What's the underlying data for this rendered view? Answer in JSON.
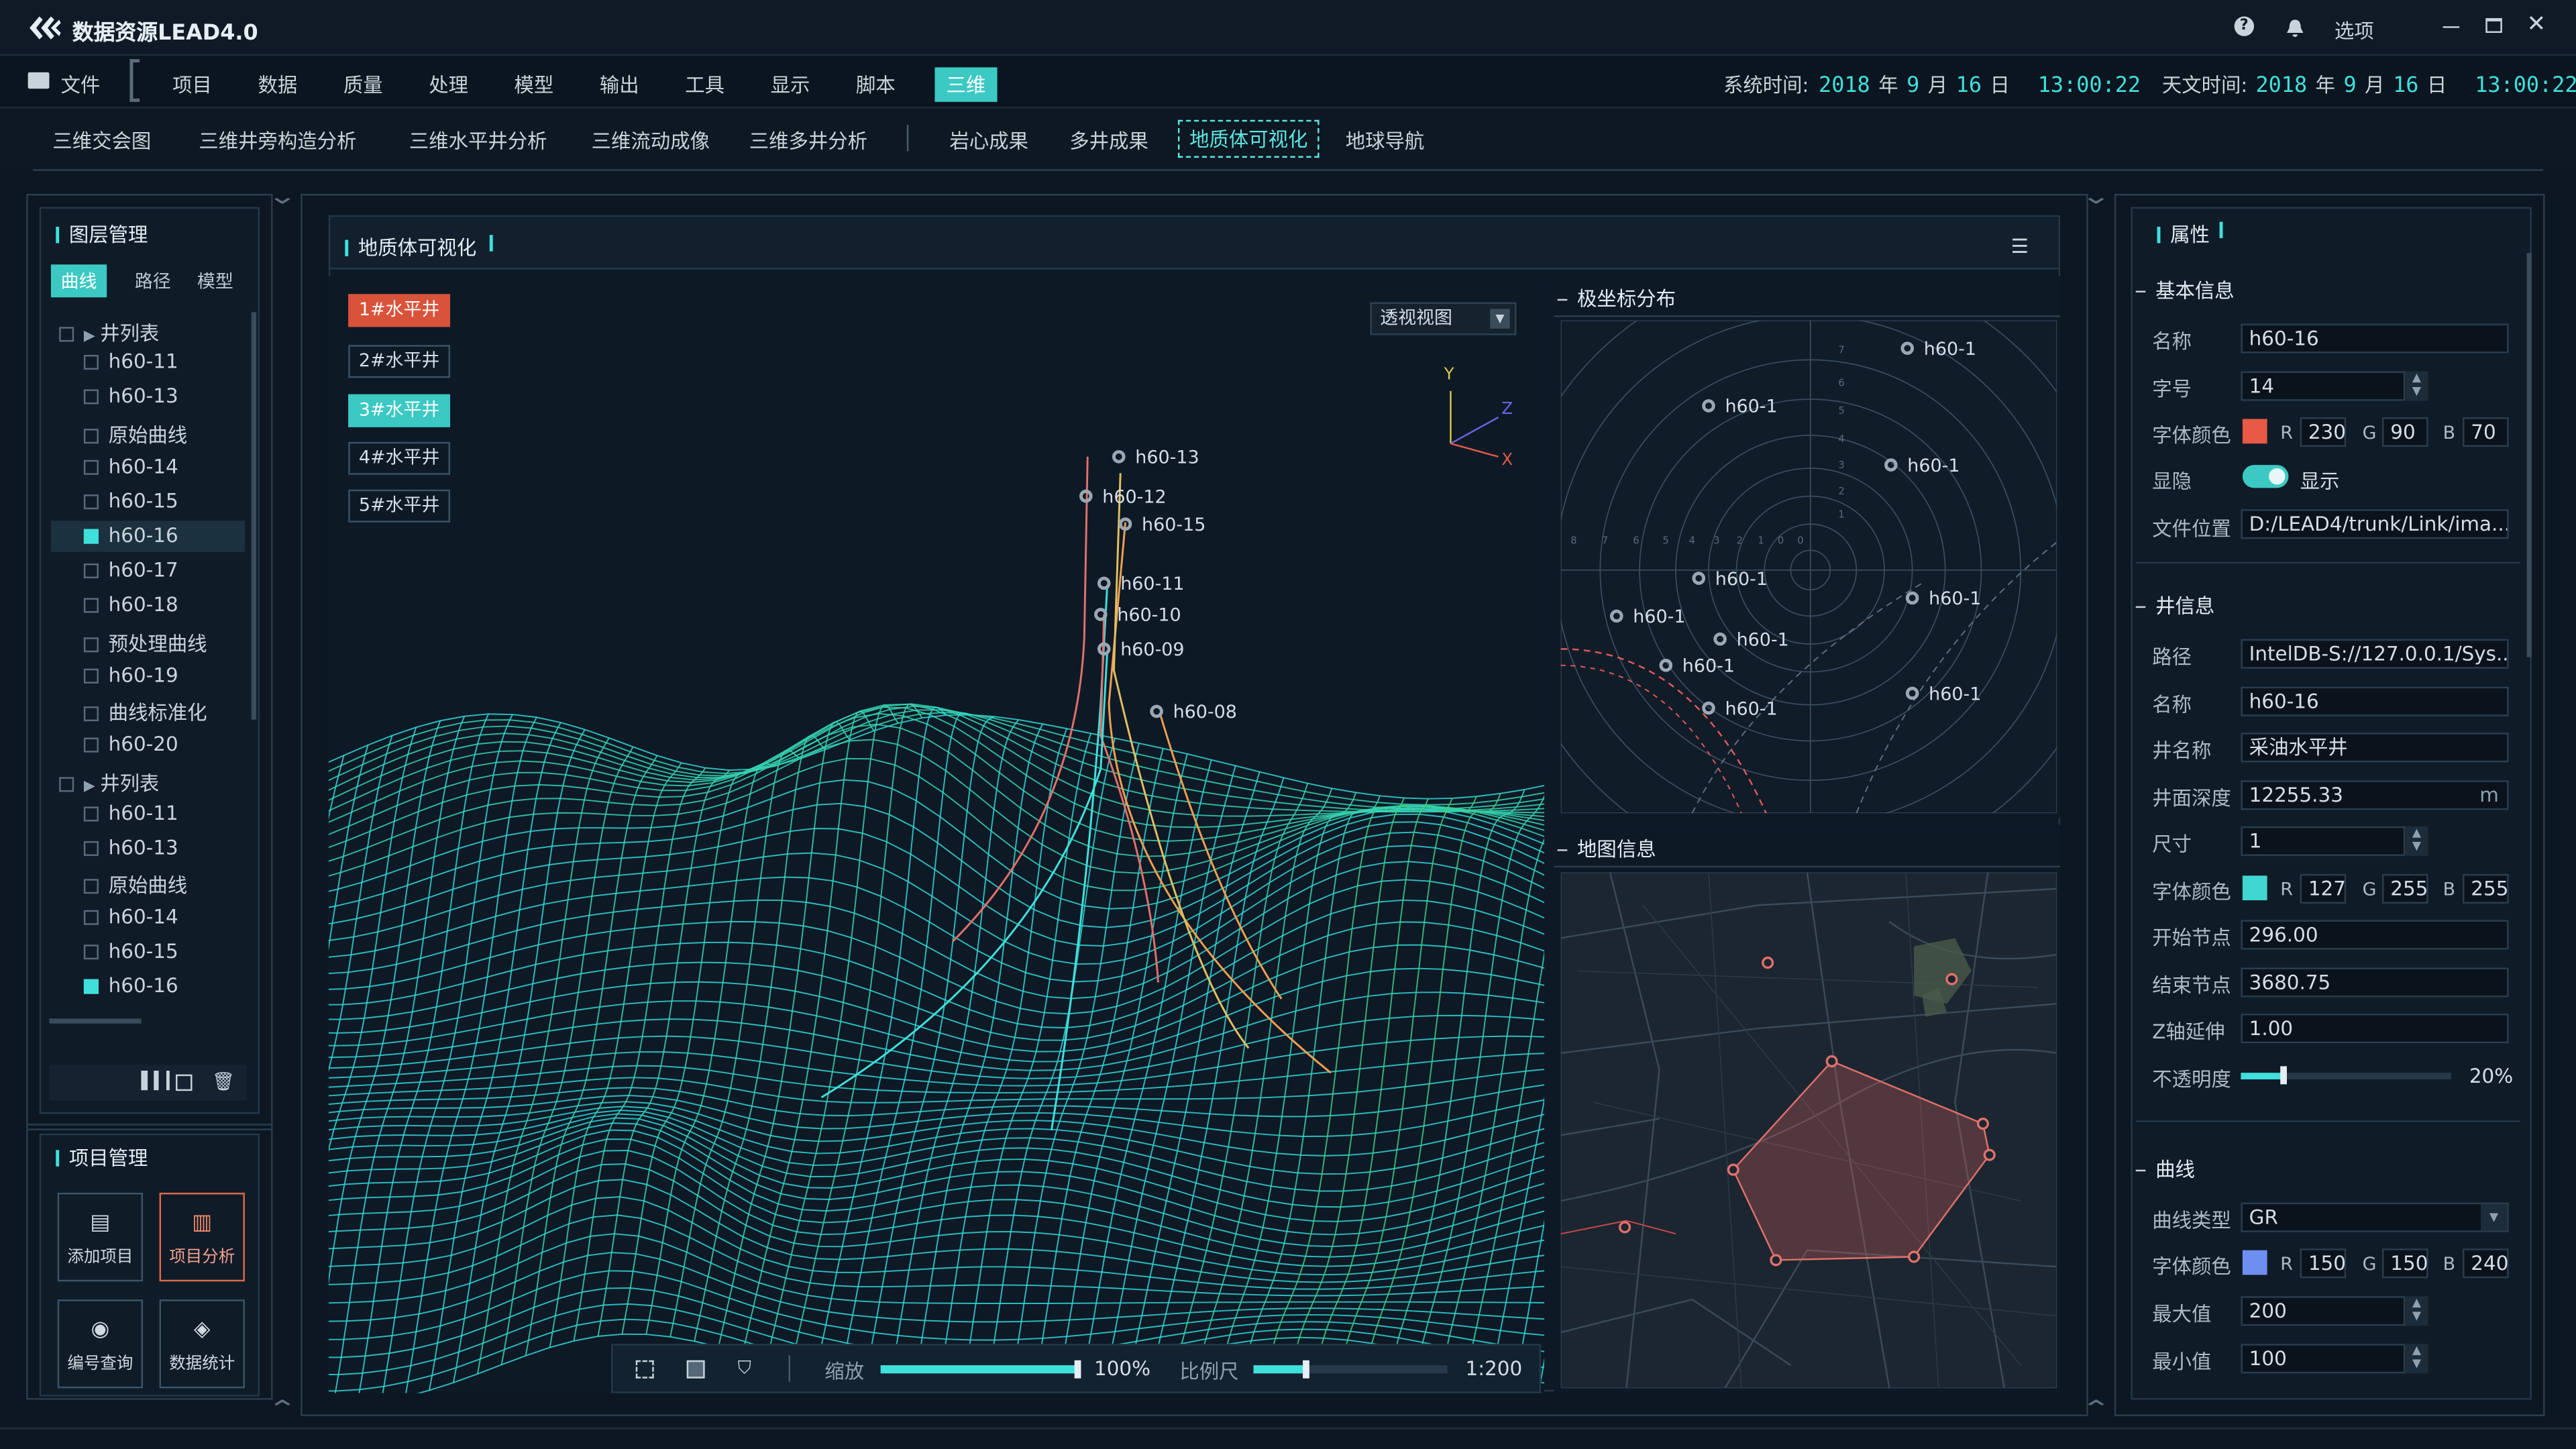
{
  "app": {
    "title": "数据资源LEAD4.0",
    "options_label": "选项"
  },
  "menu": {
    "file": "文件",
    "items": [
      "项目",
      "数据",
      "质量",
      "处理",
      "模型",
      "输出",
      "工具",
      "显示",
      "脚本",
      "三维"
    ],
    "active": "三维"
  },
  "time": {
    "system_label": "系统时间:",
    "astro_label": "天文时间:",
    "year": "2018",
    "month": "9",
    "day": "16",
    "clock": "13:00:22",
    "year_unit": "年",
    "month_unit": "月",
    "day_unit": "日"
  },
  "subtabs": {
    "items": [
      "三维交会图",
      "三维井旁构造分析",
      "三维水平井分析",
      "三维流动成像",
      "三维多井分析",
      "岩心成果",
      "多井成果",
      "地质体可视化",
      "地球导航"
    ],
    "active": "地质体可视化"
  },
  "layer_panel": {
    "title": "图层管理",
    "tabs": [
      "曲线",
      "路径",
      "模型"
    ],
    "tree": [
      {
        "label": "井列表",
        "type": "group"
      },
      {
        "label": "h60-11"
      },
      {
        "label": "h60-13"
      },
      {
        "label": "原始曲线"
      },
      {
        "label": "h60-14"
      },
      {
        "label": "h60-15"
      },
      {
        "label": "h60-16",
        "checked": true,
        "selected": true
      },
      {
        "label": "h60-17"
      },
      {
        "label": "h60-18"
      },
      {
        "label": "预处理曲线"
      },
      {
        "label": "h60-19"
      },
      {
        "label": "曲线标准化"
      },
      {
        "label": "h60-20"
      },
      {
        "label": "井列表",
        "type": "group"
      },
      {
        "label": "h60-11"
      },
      {
        "label": "h60-13"
      },
      {
        "label": "原始曲线"
      },
      {
        "label": "h60-14"
      },
      {
        "label": "h60-15"
      },
      {
        "label": "h60-16",
        "checked": true
      }
    ]
  },
  "project_panel": {
    "title": "项目管理",
    "buttons": [
      {
        "label": "添加项目",
        "icon": "add-project-icon"
      },
      {
        "label": "项目分析",
        "icon": "bar-chart-icon",
        "active": true
      },
      {
        "label": "编号查询",
        "icon": "query-icon"
      },
      {
        "label": "数据统计",
        "icon": "statistics-icon"
      }
    ]
  },
  "viz": {
    "title": "地质体可视化",
    "wells": [
      "1#水平井",
      "2#水平井",
      "3#水平井",
      "4#水平井",
      "5#水平井"
    ],
    "view_select": "透视视图",
    "axes": {
      "x": "X",
      "y": "Y",
      "z": "Z"
    },
    "well_labels": [
      "h60-13",
      "h60-12",
      "h60-15",
      "h60-11",
      "h60-10",
      "h60-09",
      "h60-08"
    ],
    "zoom_label": "缩放",
    "zoom_value": "100%",
    "zoom_level": 1.0,
    "scale_label": "比例尺",
    "scale_value": "1:200",
    "scale_level": 0.27
  },
  "polar": {
    "title": "极坐标分布",
    "point_label": "h60-1",
    "ticks_top": [
      "7",
      "6",
      "5",
      "4",
      "3",
      "2",
      "1",
      "0"
    ],
    "ticks_left": [
      "8",
      "7",
      "6",
      "5",
      "4",
      "3",
      "2",
      "1",
      "0"
    ]
  },
  "map": {
    "title": "地图信息"
  },
  "props": {
    "title": "属性",
    "basic": {
      "section": "基本信息",
      "name_label": "名称",
      "name": "h60-16",
      "size_label": "字号",
      "size": "14",
      "color_label": "字体颜色",
      "r": "230",
      "g": "90",
      "b": "70",
      "color": "#e65a46",
      "visible_label": "显隐",
      "visible_text": "显示",
      "path_label": "文件位置",
      "path": "D:/LEAD4/trunk/Link/ima..."
    },
    "well": {
      "section": "井信息",
      "path_label": "路径",
      "path": "IntelDB-S://127.0.0.1/Sys...",
      "name_label": "名称",
      "name": "h60-16",
      "well_name_label": "井名称",
      "well_name": "采油水平井",
      "depth_label": "井面深度",
      "depth": "12255.33",
      "depth_unit": "m",
      "size_label": "尺寸",
      "size": "1",
      "color_label": "字体颜色",
      "r": "127",
      "g": "255",
      "b": "255",
      "color": "#3fd6d0",
      "start_label": "开始节点",
      "start": "296.00",
      "end_label": "结束节点",
      "end": "3680.75",
      "z_label": "Z轴延伸",
      "z": "1.00",
      "opacity_label": "不透明度",
      "opacity": "20%",
      "opacity_level": 0.2
    },
    "curve": {
      "section": "曲线",
      "type_label": "曲线类型",
      "type": "GR",
      "color_label": "字体颜色",
      "r": "150",
      "g": "150",
      "b": "240",
      "color": "#6f8ff0",
      "max_label": "最大值",
      "max": "200",
      "min_label": "最小值",
      "min": "100"
    },
    "rgb": {
      "r": "R",
      "g": "G",
      "b": "B"
    }
  }
}
